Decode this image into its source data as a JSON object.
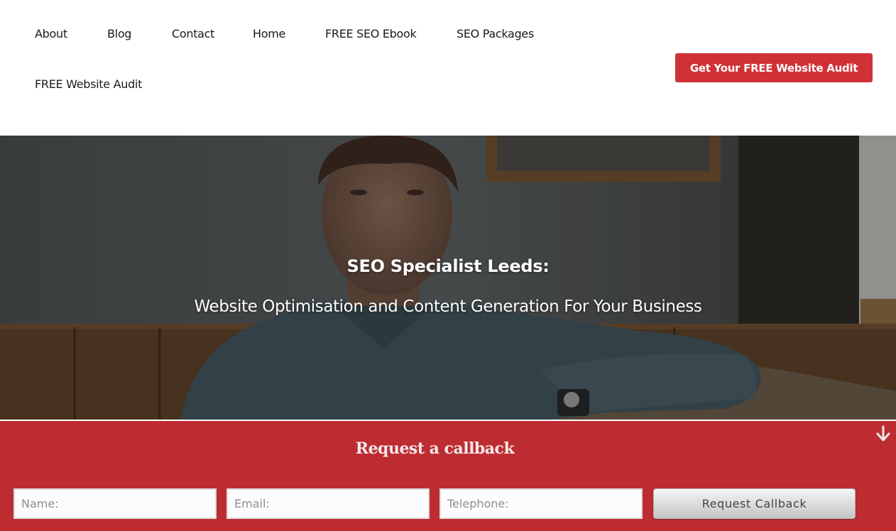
{
  "nav": {
    "items": [
      {
        "label": "About"
      },
      {
        "label": "Blog"
      },
      {
        "label": "Contact"
      },
      {
        "label": "Home"
      },
      {
        "label": "FREE SEO Ebook"
      },
      {
        "label": "SEO Packages"
      },
      {
        "label": "FREE Website Audit"
      }
    ]
  },
  "header": {
    "cta_label": "Get Your FREE Website Audit"
  },
  "hero": {
    "title": "SEO Specialist Leeds:",
    "subtitle": "Website Optimisation and Content Generation For Your Business"
  },
  "callback": {
    "title": "Request a callback",
    "collapse_icon": "arrow-down-icon",
    "name_placeholder": "Name:",
    "email_placeholder": "Email:",
    "telephone_placeholder": "Telephone:",
    "submit_label": "Request Callback"
  },
  "colors": {
    "brand_red": "#d03136",
    "callback_bar": "#bd2c31",
    "text_dark": "#1a1a1a"
  }
}
